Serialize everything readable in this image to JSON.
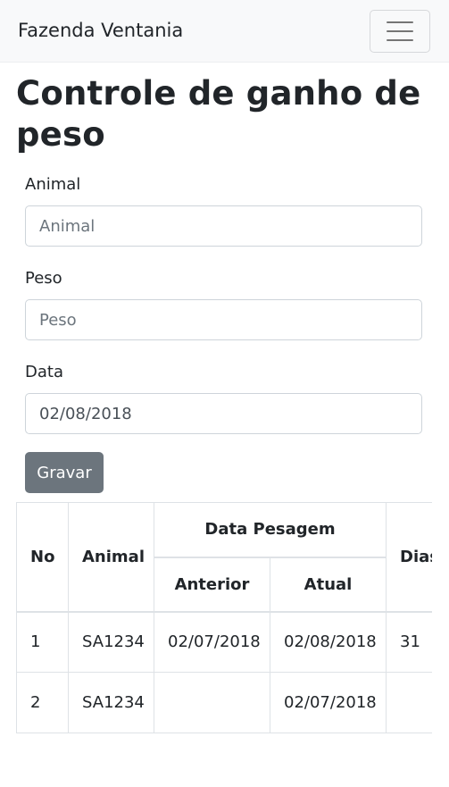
{
  "navbar": {
    "brand": "Fazenda Ventania",
    "toggler_icon": "hamburger-icon"
  },
  "page": {
    "title": "Controle de ganho de peso"
  },
  "form": {
    "animal": {
      "label": "Animal",
      "placeholder": "Animal",
      "value": ""
    },
    "peso": {
      "label": "Peso",
      "placeholder": "Peso",
      "value": ""
    },
    "data": {
      "label": "Data",
      "value": "02/08/2018"
    },
    "submit_label": "Gravar"
  },
  "table": {
    "headers": {
      "no": "No",
      "animal": "Animal",
      "data_pesagem": "Data Pesagem",
      "anterior": "Anterior",
      "atual": "Atual",
      "dias": "Dias"
    },
    "rows": [
      {
        "no": "1",
        "animal": "SA1234",
        "anterior": "02/07/2018",
        "atual": "02/08/2018",
        "dias": "31"
      },
      {
        "no": "2",
        "animal": "SA1234",
        "anterior": "",
        "atual": "02/07/2018",
        "dias": ""
      }
    ]
  },
  "colors": {
    "navbar_bg": "#f8f9fa",
    "button_bg": "#6c757d",
    "border": "#dee2e6"
  }
}
